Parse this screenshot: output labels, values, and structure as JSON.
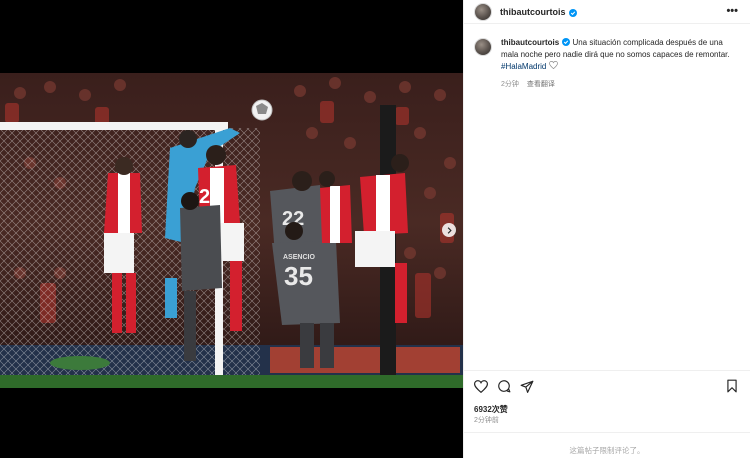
{
  "post": {
    "username": "thibautcourtois",
    "verified": true,
    "caption_text": "Una situación complicada después de una mala noche pero nadie dirá que no somos capaces de remontar.",
    "hashtag": "#HalaMadrid",
    "caption_time": "2分钟",
    "translate_label": "查看翻译",
    "likes": "6932次赞",
    "time": "2分钟前",
    "comments_closed": "这篇帖子限制评论了。"
  },
  "photo": {
    "players": [
      {
        "number": "22"
      },
      {
        "number": "35",
        "name": "ASENCIO"
      },
      {
        "number": "2"
      }
    ]
  },
  "colors": {
    "accent": "#0095f6",
    "hashtag": "#00376b",
    "arsenal_red": "#d3202e",
    "madrid_kit": "#55575c",
    "keeper_kit": "#3aa0d4"
  },
  "icons": [
    "more-icon",
    "heart-icon",
    "comment-icon",
    "share-icon",
    "bookmark-icon",
    "next-icon",
    "verified-icon"
  ]
}
